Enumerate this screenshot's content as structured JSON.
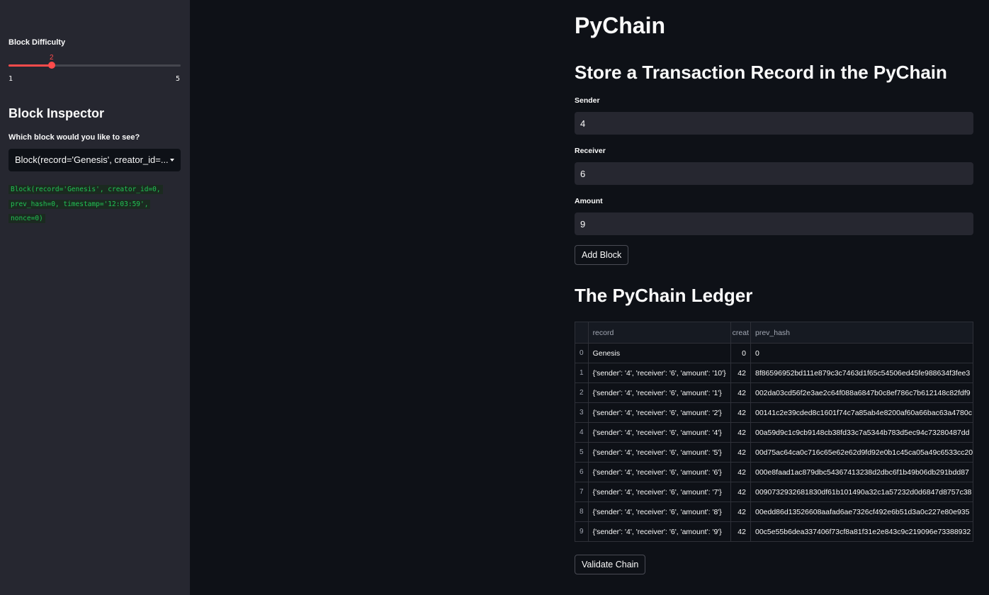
{
  "sidebar": {
    "difficulty_label": "Block Difficulty",
    "slider": {
      "min": 1,
      "max": 5,
      "value": 2
    },
    "inspector_title": "Block Inspector",
    "select_label": "Which block would you like to see?",
    "select_value": "Block(record='Genesis', creator_id=...",
    "code_lines": [
      "Block(record='Genesis', creator_id=0,",
      "prev_hash=0, timestamp='12:03:59',",
      "nonce=0)"
    ]
  },
  "main": {
    "title": "PyChain",
    "form_title": "Store a Transaction Record in the PyChain",
    "sender_label": "Sender",
    "sender_value": "4",
    "receiver_label": "Receiver",
    "receiver_value": "6",
    "amount_label": "Amount",
    "amount_value": "9",
    "add_block_label": "Add Block",
    "ledger_title": "The PyChain Ledger",
    "validate_label": "Validate Chain"
  },
  "table": {
    "columns": [
      "",
      "record",
      "creat",
      "prev_hash"
    ],
    "rows": [
      [
        "0",
        "Genesis",
        "0",
        "0"
      ],
      [
        "1",
        "{'sender': '4', 'receiver': '6', 'amount': '10'}",
        "42",
        "8f86596952bd111e879c3c7463d1f65c54506ed45fe988634f3fee3"
      ],
      [
        "2",
        "{'sender': '4', 'receiver': '6', 'amount': '1'}",
        "42",
        "002da03cd56f2e3ae2c64f088a6847b0c8ef786c7b612148c82fdf9"
      ],
      [
        "3",
        "{'sender': '4', 'receiver': '6', 'amount': '2'}",
        "42",
        "00141c2e39cded8c1601f74c7a85ab4e8200af60a66bac63a4780c"
      ],
      [
        "4",
        "{'sender': '4', 'receiver': '6', 'amount': '4'}",
        "42",
        "00a59d9c1c9cb9148cb38fd33c7a5344b783d5ec94c73280487dd"
      ],
      [
        "5",
        "{'sender': '4', 'receiver': '6', 'amount': '5'}",
        "42",
        "00d75ac64ca0c716c65e62e62d9fd92e0b1c45ca05a49c6533cc20"
      ],
      [
        "6",
        "{'sender': '4', 'receiver': '6', 'amount': '6'}",
        "42",
        "000e8faad1ac879dbc54367413238d2dbc6f1b49b06db291bdd87"
      ],
      [
        "7",
        "{'sender': '4', 'receiver': '6', 'amount': '7'}",
        "42",
        "0090732932681830df61b101490a32c1a57232d0d6847d8757c38"
      ],
      [
        "8",
        "{'sender': '4', 'receiver': '6', 'amount': '8'}",
        "42",
        "00edd86d13526608aafad6ae7326cf492e6b51d3a0c227e80e935"
      ],
      [
        "9",
        "{'sender': '4', 'receiver': '6', 'amount': '9'}",
        "42",
        "00c5e55b6dea337406f73cf8a81f31e2e843c9c219096e73388932"
      ]
    ]
  },
  "colors": {
    "accent": "#ff4b4b",
    "code_green": "#21c354",
    "sidebar_bg": "#262730",
    "main_bg": "#0e1117"
  }
}
